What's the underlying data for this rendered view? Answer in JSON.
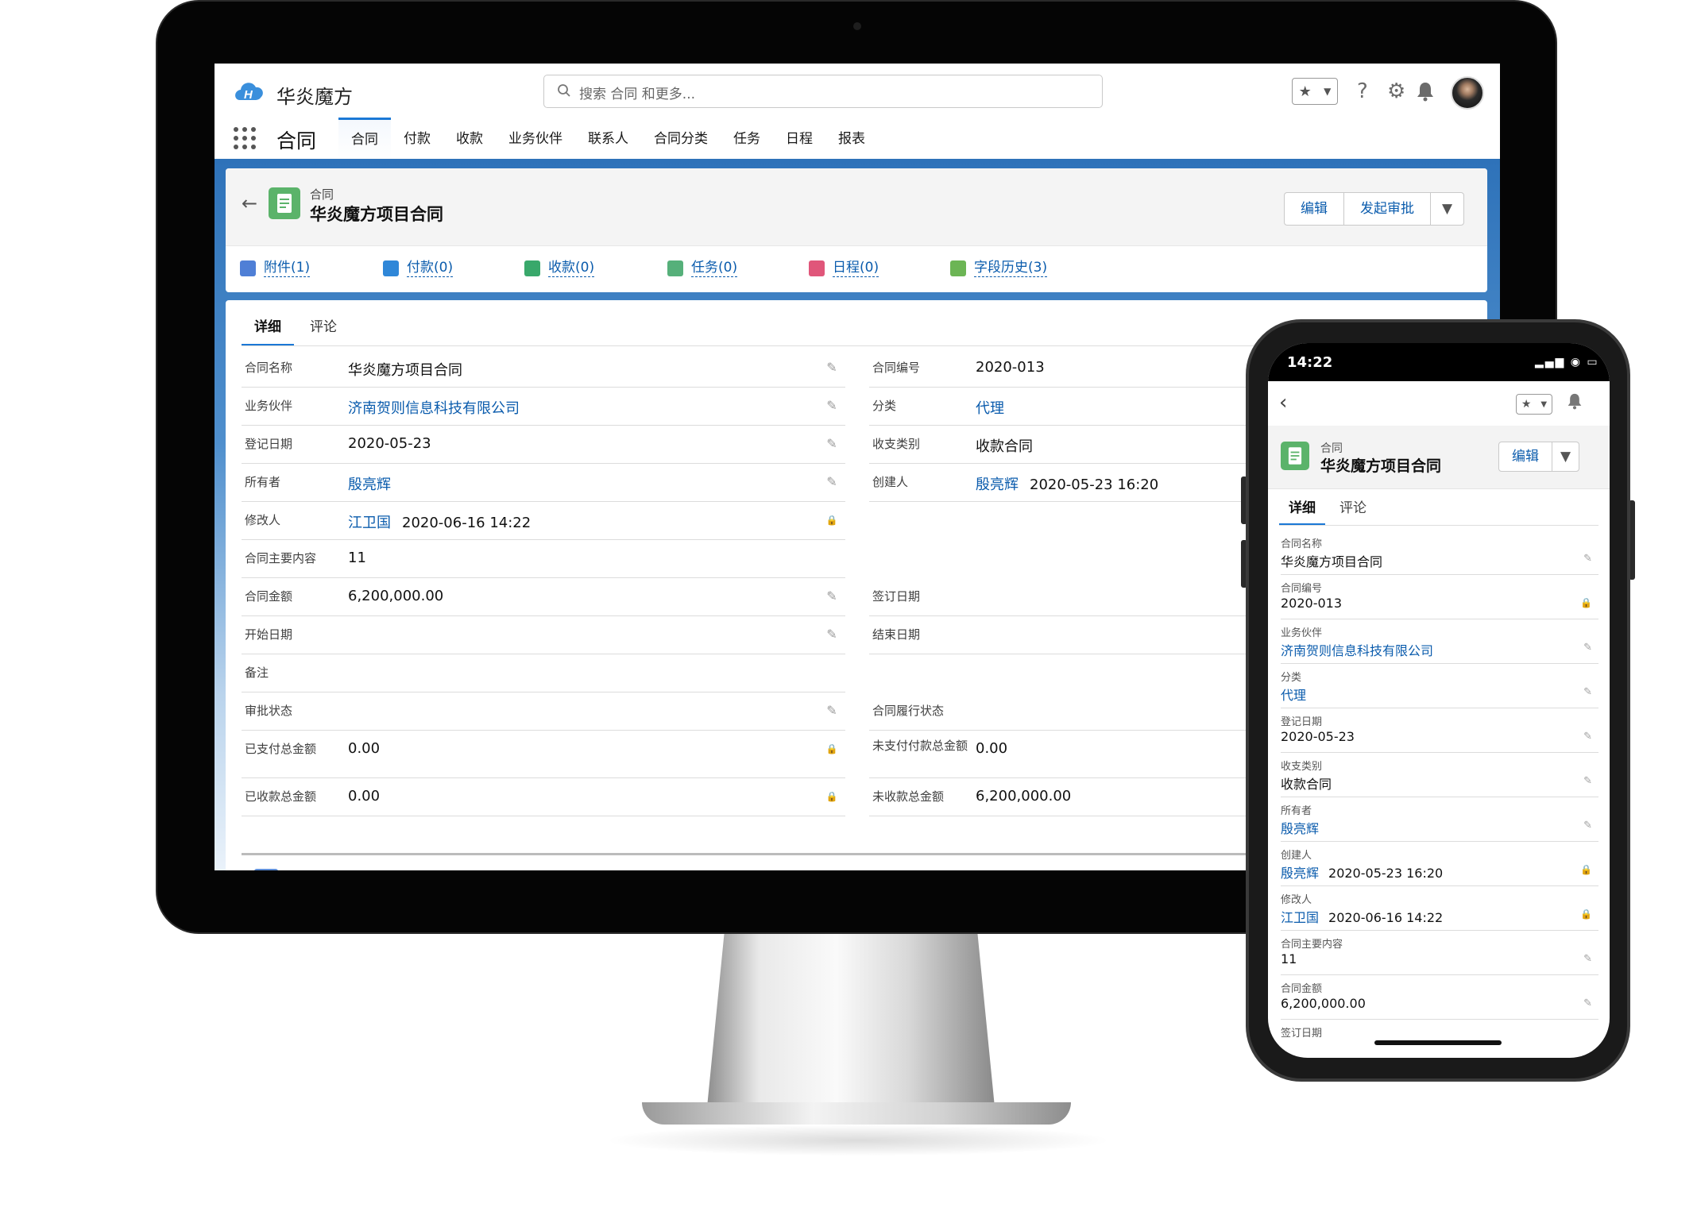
{
  "header": {
    "app_name": "华炎魔方",
    "search_placeholder": "搜索 合同 和更多...",
    "app_title": "合同"
  },
  "nav": {
    "items": [
      "合同",
      "付款",
      "收款",
      "业务伙伴",
      "联系人",
      "合同分类",
      "任务",
      "日程",
      "报表"
    ],
    "active": "合同"
  },
  "record": {
    "type": "合同",
    "name": "华炎魔方项目合同",
    "buttons": {
      "edit": "编辑",
      "approve": "发起审批"
    },
    "related": [
      {
        "label": "附件(1)",
        "icon": "attachment-icon",
        "color": "#4f7fd6"
      },
      {
        "label": "付款(0)",
        "icon": "upload-icon",
        "color": "#2f87d8"
      },
      {
        "label": "收款(0)",
        "icon": "download-icon",
        "color": "#39a86b"
      },
      {
        "label": "任务(0)",
        "icon": "task-icon",
        "color": "#56b07a"
      },
      {
        "label": "日程(0)",
        "icon": "calendar-icon",
        "color": "#e0567a"
      },
      {
        "label": "字段历史(3)",
        "icon": "history-icon",
        "color": "#6cb555"
      }
    ]
  },
  "detail": {
    "tabs": [
      "详细",
      "评论"
    ],
    "left": [
      {
        "label": "合同名称",
        "value": "华炎魔方项目合同",
        "edit": "pencil"
      },
      {
        "label": "业务伙伴",
        "link": "济南贺则信息科技有限公司",
        "edit": "pencil"
      },
      {
        "label": "登记日期",
        "value": "2020-05-23",
        "edit": "pencil"
      },
      {
        "label": "所有者",
        "link": "殷亮辉",
        "edit": "pencil"
      },
      {
        "label": "修改人",
        "link": "江卫国",
        "value": "2020-06-16 14:22",
        "edit": "lock"
      },
      {
        "label": "合同主要内容",
        "value": "11",
        "edit": "none"
      },
      {
        "label": "合同金额",
        "value": "6,200,000.00",
        "edit": "pencil"
      },
      {
        "label": "开始日期",
        "value": "",
        "edit": "pencil"
      },
      {
        "label": "备注",
        "value": "",
        "edit": "none"
      },
      {
        "label": "审批状态",
        "value": "",
        "edit": "pencil"
      },
      {
        "label": "已支付总金额",
        "value": "0.00",
        "edit": "lock"
      },
      {
        "label": "已收款总金额",
        "value": "0.00",
        "edit": "lock"
      }
    ],
    "right": [
      {
        "label": "合同编号",
        "value": "2020-013"
      },
      {
        "label": "分类",
        "link": "代理"
      },
      {
        "label": "收支类别",
        "value": "收款合同"
      },
      {
        "label": "创建人",
        "link": "殷亮辉",
        "value": "2020-05-23 16:20"
      },
      {
        "label": "",
        "value": ""
      },
      {
        "label": "",
        "value": ""
      },
      {
        "label": "签订日期",
        "value": ""
      },
      {
        "label": "结束日期",
        "value": ""
      },
      {
        "label": "",
        "value": ""
      },
      {
        "label": "合同履行状态",
        "value": ""
      },
      {
        "label": "未支付付款总金额",
        "value": "0.00"
      },
      {
        "label": "未收款总金额",
        "value": "6,200,000.00"
      }
    ]
  },
  "phone": {
    "time": "14:22",
    "record_type": "合同",
    "record_name": "华炎魔方项目合同",
    "edit_label": "编辑",
    "tabs": [
      "详细",
      "评论"
    ],
    "fields": [
      {
        "label": "合同名称",
        "value": "华炎魔方项目合同",
        "edit": "pencil"
      },
      {
        "label": "合同编号",
        "value": "2020-013",
        "edit": "lock"
      },
      {
        "label": "业务伙伴",
        "link": "济南贺则信息科技有限公司",
        "edit": "pencil"
      },
      {
        "label": "分类",
        "link": "代理",
        "edit": "pencil"
      },
      {
        "label": "登记日期",
        "value": "2020-05-23",
        "edit": "pencil"
      },
      {
        "label": "收支类别",
        "value": "收款合同",
        "edit": "pencil"
      },
      {
        "label": "所有者",
        "link": "殷亮辉",
        "edit": "pencil"
      },
      {
        "label": "创建人",
        "link": "殷亮辉",
        "value": "2020-05-23 16:20",
        "edit": "lock"
      },
      {
        "label": "修改人",
        "link": "江卫国",
        "value": "2020-06-16 14:22",
        "edit": "lock"
      },
      {
        "label": "合同主要内容",
        "value": "11",
        "edit": "pencil"
      },
      {
        "label": "合同金额",
        "value": "6,200,000.00",
        "edit": "pencil"
      },
      {
        "label": "签订日期",
        "value": "",
        "edit": "none"
      }
    ]
  }
}
